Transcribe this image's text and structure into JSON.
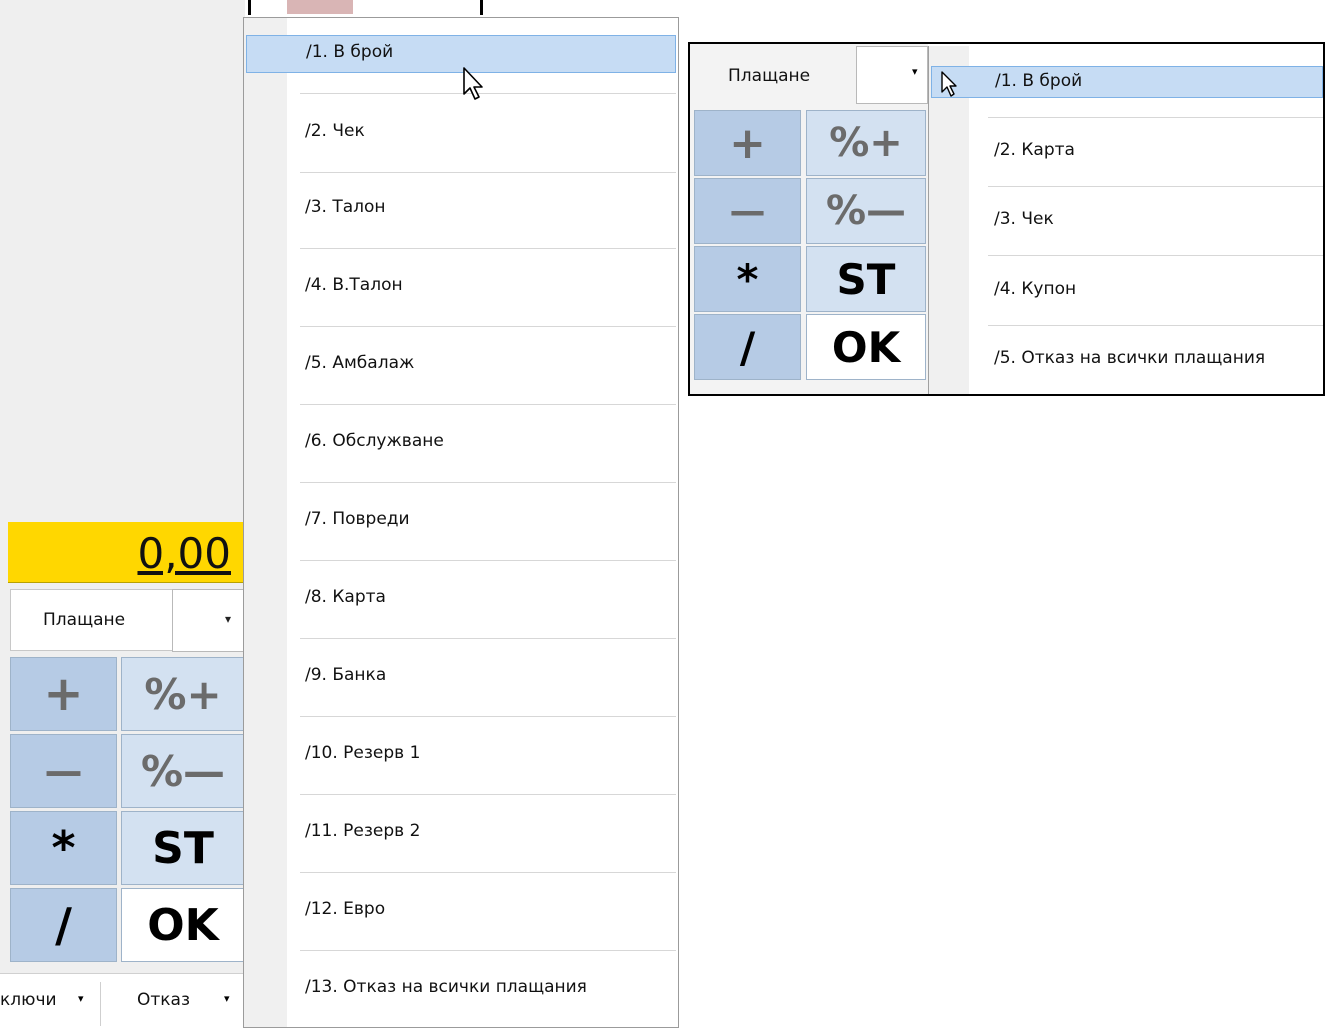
{
  "left_panel": {
    "total_value": "0,00",
    "payment_label": "Плащане",
    "combo_arrow": "▾",
    "keys": {
      "plus": "+",
      "percent_plus": "%+",
      "minus": "—",
      "percent_minus": "%—",
      "multiply": "*",
      "subtotal": "ST",
      "divide": "/",
      "ok": "OK"
    },
    "bottom_buttons": [
      {
        "label": "ключи"
      },
      {
        "label": "Отказ"
      }
    ]
  },
  "big_dropdown": {
    "items": [
      {
        "label": "/1. В брой",
        "selected": true
      },
      {
        "label": "/2. Чек"
      },
      {
        "label": "/3. Талон"
      },
      {
        "label": "/4. В.Талон"
      },
      {
        "label": "/5. Амбалаж"
      },
      {
        "label": "/6. Обслужване"
      },
      {
        "label": "/7. Повреди"
      },
      {
        "label": "/8. Карта"
      },
      {
        "label": "/9. Банка"
      },
      {
        "label": "/10. Резерв 1"
      },
      {
        "label": "/11. Резерв 2"
      },
      {
        "label": "/12. Евро"
      },
      {
        "label": "/13. Отказ на всички плащания"
      }
    ]
  },
  "inset_panel": {
    "payment_label": "Плащане",
    "keys": {
      "plus": "+",
      "percent_plus": "%+",
      "minus": "—",
      "percent_minus": "%—",
      "multiply": "*",
      "subtotal": "ST",
      "divide": "/",
      "ok": "OK"
    },
    "items": [
      {
        "label": "/1. В брой",
        "selected": true
      },
      {
        "label": "/2. Карта"
      },
      {
        "label": "/3. Чек"
      },
      {
        "label": "/4. Купон"
      },
      {
        "label": "/5. Отказ на всички плащания"
      }
    ]
  },
  "colors": {
    "total_bg": "#ffd700",
    "selection_bg": "#c6dcf4",
    "key_dark": "#b6cbe5",
    "key_light": "#d3e1f1"
  },
  "icons": [
    "mouse-cursor-icon",
    "chevron-down-icon"
  ]
}
